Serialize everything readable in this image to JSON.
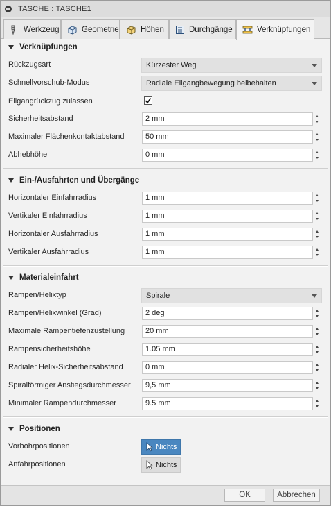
{
  "window": {
    "title": "TASCHE : TASCHE1"
  },
  "tabs": [
    {
      "label": "Werkzeug",
      "icon": "tool-icon"
    },
    {
      "label": "Geometrie",
      "icon": "geometry-cube-icon"
    },
    {
      "label": "Höhen",
      "icon": "heights-box-icon"
    },
    {
      "label": "Durchgänge",
      "icon": "passes-icon"
    },
    {
      "label": "Verknüpfungen",
      "icon": "linking-icon",
      "active": true
    }
  ],
  "sections": {
    "linking": {
      "title": "Verknüpfungen",
      "retract_type": {
        "label": "Rückzugsart",
        "value": "Kürzester Weg"
      },
      "rapid_mode": {
        "label": "Schnellvorschub-Modus",
        "value": "Radiale Eilgangbewegung beibehalten"
      },
      "allow_rapid_retract": {
        "label": "Eilgangrückzug zulassen",
        "checked": true
      },
      "safe_distance": {
        "label": "Sicherheitsabstand",
        "value": "2 mm"
      },
      "max_stay_down": {
        "label": "Maximaler Flächenkontaktabstand",
        "value": "50 mm"
      },
      "lift_height": {
        "label": "Abhebhöhe",
        "value": "0 mm"
      }
    },
    "leads": {
      "title": "Ein-/Ausfahrten und Übergänge",
      "h_entry_radius": {
        "label": "Horizontaler Einfahrradius",
        "value": "1 mm"
      },
      "v_entry_radius": {
        "label": "Vertikaler Einfahrradius",
        "value": "1 mm"
      },
      "h_exit_radius": {
        "label": "Horizontaler Ausfahrradius",
        "value": "1 mm"
      },
      "v_exit_radius": {
        "label": "Vertikaler Ausfahrradius",
        "value": "1 mm"
      }
    },
    "ramp": {
      "title": "Materialeinfahrt",
      "ramp_type": {
        "label": "Rampen/Helixtyp",
        "value": "Spirale"
      },
      "ramp_angle": {
        "label": "Rampen/Helixwinkel (Grad)",
        "value": "2 deg"
      },
      "max_stepdown": {
        "label": "Maximale Rampentiefenzustellung",
        "value": "20 mm"
      },
      "ramp_clearance": {
        "label": "Rampensicherheitshöhe",
        "value": "1.05 mm"
      },
      "helix_clearance": {
        "label": "Radialer Helix-Sicherheitsabstand",
        "value": "0 mm"
      },
      "spiral_diameter": {
        "label": "Spiralförmiger Anstiegsdurchmesser",
        "value": "9,5 mm"
      },
      "min_ramp_diameter": {
        "label": "Minimaler Rampendurchmesser",
        "value": "9.5 mm"
      }
    },
    "positions": {
      "title": "Positionen",
      "predrill": {
        "label": "Vorbohrpositionen",
        "button": "Nichts"
      },
      "entry": {
        "label": "Anfahrpositionen",
        "button": "Nichts"
      }
    }
  },
  "footer": {
    "ok": "OK",
    "cancel": "Abbrechen"
  },
  "colors": {
    "accent": "#4a87c0",
    "panel": "#f2f2f2",
    "titlebar": "#dcdcdc"
  }
}
